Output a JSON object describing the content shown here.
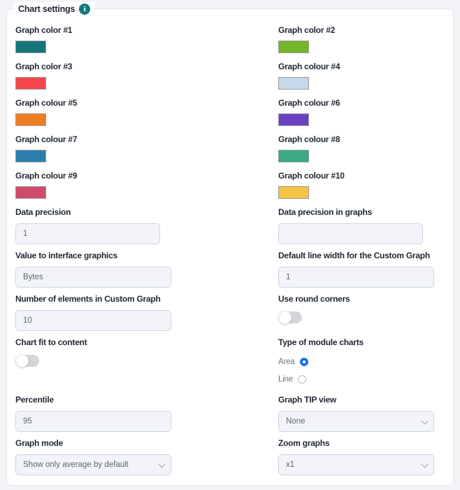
{
  "panel": {
    "legend": "Chart settings",
    "info_icon": "info-icon"
  },
  "colors": {
    "graph_1": "#14757a",
    "graph_2": "#76b62b",
    "graph_3": "#f6454b",
    "graph_4": "#c4d9ea",
    "graph_5": "#ee7d22",
    "graph_6": "#6b41c4",
    "graph_7": "#2a7fae",
    "graph_8": "#3bab84",
    "graph_9": "#cf4a6b",
    "graph_10": "#f5c443"
  },
  "left": [
    {
      "label": "Graph color #1",
      "type": "swatch",
      "color_key": "graph_1",
      "name": "graph-color-1-swatch"
    },
    {
      "label": "Graph color #3",
      "type": "swatch",
      "color_key": "graph_3",
      "name": "graph-color-3-swatch"
    },
    {
      "label": "Graph colour #5",
      "type": "swatch",
      "color_key": "graph_5",
      "name": "graph-colour-5-swatch"
    },
    {
      "label": "Graph colour #7",
      "type": "swatch",
      "color_key": "graph_7",
      "name": "graph-colour-7-swatch"
    },
    {
      "label": "Graph colour #9",
      "type": "swatch",
      "color_key": "graph_9",
      "name": "graph-colour-9-swatch"
    }
  ],
  "right": [
    {
      "label": "Graph color #2",
      "type": "swatch",
      "color_key": "graph_2",
      "name": "graph-color-2-swatch"
    },
    {
      "label": "Graph colour #4",
      "type": "swatch",
      "color_key": "graph_4",
      "name": "graph-colour-4-swatch"
    },
    {
      "label": "Graph colour #6",
      "type": "swatch",
      "color_key": "graph_6",
      "name": "graph-colour-6-swatch"
    },
    {
      "label": "Graph colour #8",
      "type": "swatch",
      "color_key": "graph_8",
      "name": "graph-colour-8-swatch"
    },
    {
      "label": "Graph colour #10",
      "type": "swatch",
      "color_key": "graph_10",
      "name": "graph-colour-10-swatch"
    }
  ],
  "fields": {
    "data_precision": {
      "label": "Data precision",
      "value": "1"
    },
    "data_precision_graphs": {
      "label": "Data precision in graphs",
      "value": ""
    },
    "value_interface": {
      "label": "Value to interface graphics",
      "value": "Bytes"
    },
    "default_line_width": {
      "label": "Default line width for the Custom Graph",
      "value": "1"
    },
    "num_elements": {
      "label": "Number of elements in Custom Graph",
      "value": "10"
    },
    "use_round_corners": {
      "label": "Use round corners",
      "state": "off"
    },
    "chart_fit": {
      "label": "Chart fit to content",
      "state": "off"
    },
    "type_module_charts": {
      "label": "Type of module charts",
      "options": [
        {
          "label": "Area",
          "selected": true
        },
        {
          "label": "Line",
          "selected": false
        }
      ]
    },
    "percentile": {
      "label": "Percentile",
      "value": "95"
    },
    "graph_tip_view": {
      "label": "Graph TIP view",
      "value": "None"
    },
    "graph_mode": {
      "label": "Graph mode",
      "value": "Show only average by default"
    },
    "zoom_graphs": {
      "label": "Zoom graphs",
      "value": "x1"
    }
  }
}
